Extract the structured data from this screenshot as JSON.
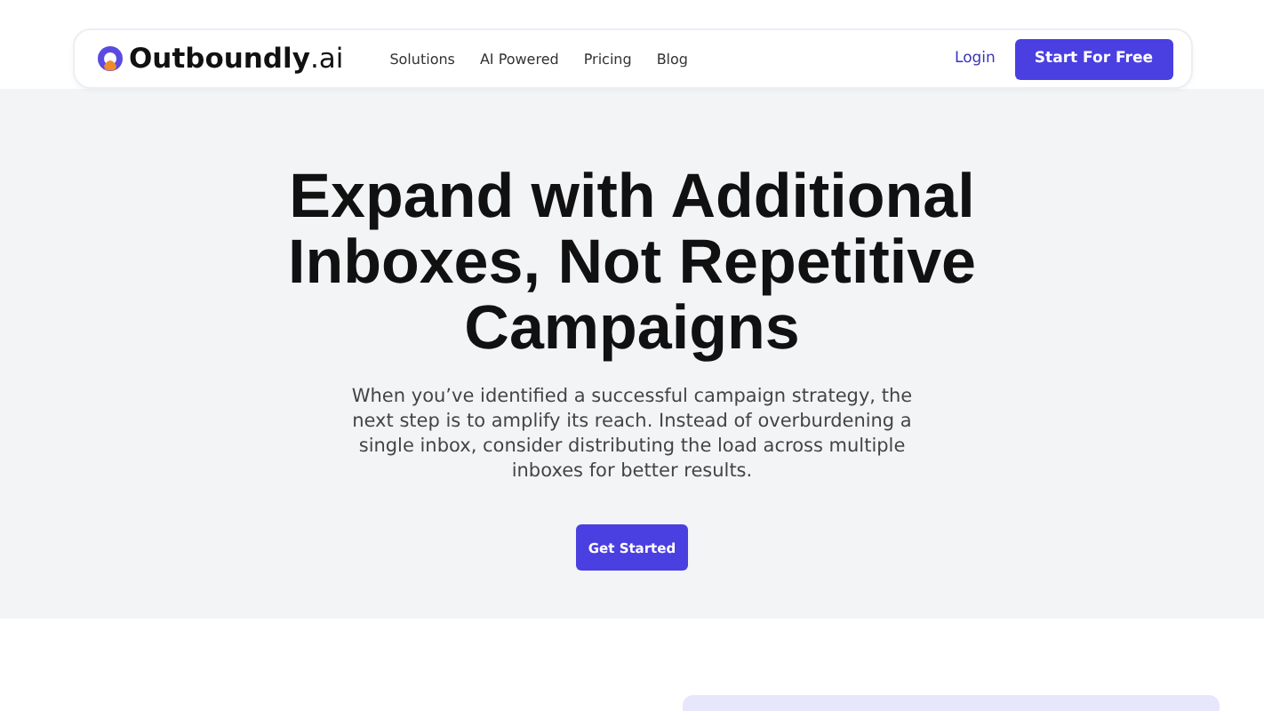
{
  "navbar": {
    "logo": "**Outboundly**.ai",
    "links": [
      "Solutions",
      "AI Powered",
      "Pricing",
      "Blog"
    ],
    "login": "Login",
    "cta": "Start For Free"
  },
  "hero": {
    "title": "Expand with Additional Inboxes, Not Repetitive Campaigns",
    "description": "When you’ve identified a successful campaign strategy, the next step is to amplify its reach. Instead of overburdening a single inbox, consider distributing the load across multiple inboxes for better results.",
    "button": "Get Started"
  }
}
